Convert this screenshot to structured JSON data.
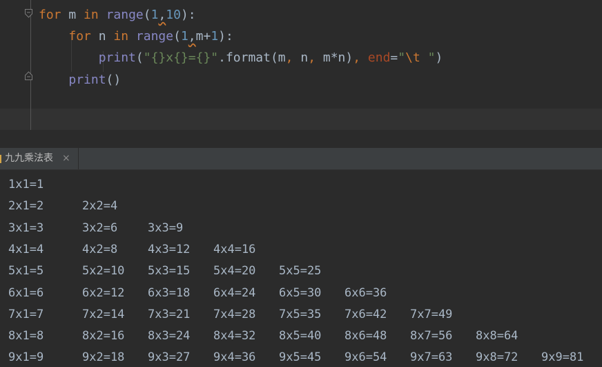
{
  "editor": {
    "lines": [
      {
        "tokens": [
          {
            "t": "for",
            "c": "kw"
          },
          {
            "t": " m ",
            "c": ""
          },
          {
            "t": "in",
            "c": "kw"
          },
          {
            "t": " ",
            "c": ""
          },
          {
            "t": "range",
            "c": "bi"
          },
          {
            "t": "(",
            "c": ""
          },
          {
            "t": "1",
            "c": "num"
          },
          {
            "t": ",",
            "c": "squig"
          },
          {
            "t": "10",
            "c": "num"
          },
          {
            "t": "):",
            "c": ""
          }
        ]
      },
      {
        "tokens": [
          {
            "t": "    ",
            "c": ""
          },
          {
            "t": "for",
            "c": "kw"
          },
          {
            "t": " n ",
            "c": ""
          },
          {
            "t": "in",
            "c": "kw"
          },
          {
            "t": " ",
            "c": ""
          },
          {
            "t": "range",
            "c": "bi"
          },
          {
            "t": "(",
            "c": ""
          },
          {
            "t": "1",
            "c": "num"
          },
          {
            "t": ",",
            "c": "squig"
          },
          {
            "t": "m+",
            "c": ""
          },
          {
            "t": "1",
            "c": "num"
          },
          {
            "t": "):",
            "c": ""
          }
        ]
      },
      {
        "tokens": [
          {
            "t": "        ",
            "c": ""
          },
          {
            "t": "print",
            "c": "bi"
          },
          {
            "t": "(",
            "c": ""
          },
          {
            "t": "\"{}x{}={}\"",
            "c": "str"
          },
          {
            "t": ".format(m",
            "c": ""
          },
          {
            "t": ",",
            "c": "kw"
          },
          {
            "t": " n",
            "c": ""
          },
          {
            "t": ",",
            "c": "kw"
          },
          {
            "t": " m*n)",
            "c": ""
          },
          {
            "t": ",",
            "c": "kw"
          },
          {
            "t": " ",
            "c": ""
          },
          {
            "t": "end",
            "c": "param"
          },
          {
            "t": "=",
            "c": ""
          },
          {
            "t": "\"",
            "c": "str"
          },
          {
            "t": "\\t",
            "c": "fmt"
          },
          {
            "t": " \"",
            "c": "str"
          },
          {
            "t": ")",
            "c": ""
          }
        ]
      },
      {
        "tokens": [
          {
            "t": "    ",
            "c": ""
          },
          {
            "t": "print",
            "c": "bi"
          },
          {
            "t": "()",
            "c": ""
          }
        ]
      }
    ]
  },
  "run_tab": {
    "label": "九九乘法表",
    "close_glyph": "×"
  },
  "console": {
    "rows": [
      [
        "1x1=1"
      ],
      [
        "2x1=2",
        "2x2=4"
      ],
      [
        "3x1=3",
        "3x2=6",
        "3x3=9"
      ],
      [
        "4x1=4",
        "4x2=8",
        "4x3=12",
        "4x4=16"
      ],
      [
        "5x1=5",
        "5x2=10",
        "5x3=15",
        "5x4=20",
        "5x5=25"
      ],
      [
        "6x1=6",
        "6x2=12",
        "6x3=18",
        "6x4=24",
        "6x5=30",
        "6x6=36"
      ],
      [
        "7x1=7",
        "7x2=14",
        "7x3=21",
        "7x4=28",
        "7x5=35",
        "7x6=42",
        "7x7=49"
      ],
      [
        "8x1=8",
        "8x2=16",
        "8x3=24",
        "8x4=32",
        "8x5=40",
        "8x6=48",
        "8x7=56",
        "8x8=64"
      ],
      [
        "9x1=9",
        "9x2=18",
        "9x3=27",
        "9x4=36",
        "9x5=45",
        "9x6=54",
        "9x7=63",
        "9x8=72",
        "9x9=81"
      ]
    ]
  },
  "colors": {
    "background": "#2b2b2b",
    "keyword": "#cc7832",
    "builtin": "#8888c6",
    "number": "#6897bb",
    "string": "#6a8759",
    "text": "#a9b7c6"
  }
}
